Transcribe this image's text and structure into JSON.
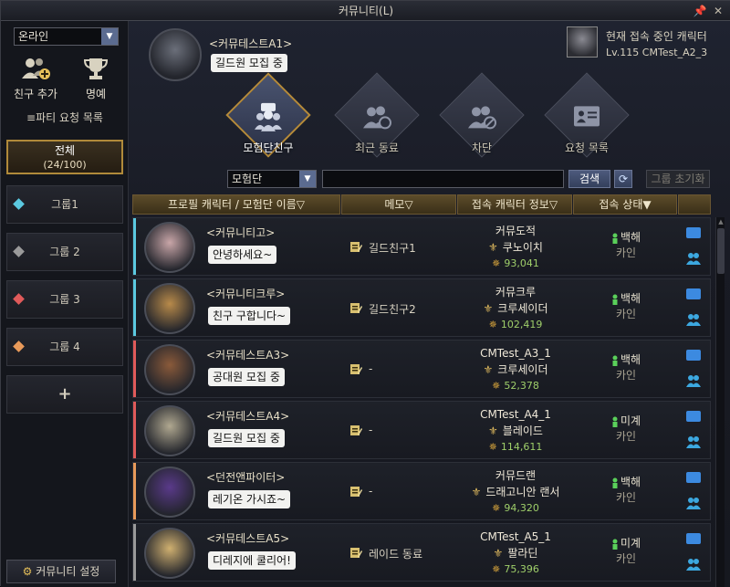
{
  "window": {
    "title": "커뮤니티(L)"
  },
  "left": {
    "status_value": "온라인",
    "add_friend_label": "친구 추가",
    "honor_label": "명예",
    "party_request_label": "≡파티 요청 목록",
    "all_label": "전체",
    "all_count": "(24/100)",
    "groups": [
      {
        "label": "그룹1",
        "color": "#5bc9e0"
      },
      {
        "label": "그룹 2",
        "color": "#9a9a9a"
      },
      {
        "label": "그룹 3",
        "color": "#e05a5a"
      },
      {
        "label": "그룹 4",
        "color": "#e89a5a"
      }
    ],
    "add_group_label": "+",
    "settings_label": "커뮤니티 설정"
  },
  "me": {
    "name": "<커뮤테스트A1>",
    "message": "길드원 모집 중",
    "current_label": "현재 접속 중인 캐릭터",
    "current_info": "Lv.115 CMTest_A2_3"
  },
  "tabs": [
    {
      "label": "모험단친구",
      "icon": "adventure-friends-icon"
    },
    {
      "label": "최근 동료",
      "icon": "recent-party-icon"
    },
    {
      "label": "차단",
      "icon": "block-icon"
    },
    {
      "label": "요청 목록",
      "icon": "request-list-icon"
    }
  ],
  "search": {
    "filter_value": "모험단",
    "query": "",
    "search_label": "검색",
    "reset_label": "그룹 초기화"
  },
  "columns": [
    "프로필 캐릭터 / 모험단 이름▽",
    "메모▽",
    "접속 캐릭터 정보▽",
    "접속 상태▼"
  ],
  "friends": [
    {
      "name": "<커뮤니티고>",
      "message": "안녕하세요~",
      "memo": "길드친구1",
      "char_name": "커뮤도적",
      "job": "쿠노이치",
      "power": "93,041",
      "server": "백해",
      "channel": "카인",
      "group_color": "#5bc9e0",
      "avatar_color": "#c9a6a8"
    },
    {
      "name": "<커뮤니티크루>",
      "message": "친구 구합니다~",
      "memo": "길드친구2",
      "char_name": "커뮤크루",
      "job": "크루세이더",
      "power": "102,419",
      "server": "백해",
      "channel": "카인",
      "group_color": "#5bc9e0",
      "avatar_color": "#b88a4a"
    },
    {
      "name": "<커뮤테스트A3>",
      "message": "공대원 모집 중",
      "memo": "-",
      "char_name": "CMTest_A3_1",
      "job": "크루세이더",
      "power": "52,378",
      "server": "백해",
      "channel": "카인",
      "group_color": "#e05a5a",
      "avatar_color": "#8a5a3a"
    },
    {
      "name": "<커뮤테스트A4>",
      "message": "길드원 모집 중",
      "memo": "-",
      "char_name": "CMTest_A4_1",
      "job": "블레이드",
      "power": "114,611",
      "server": "미계",
      "channel": "카인",
      "group_color": "#e05a5a",
      "avatar_color": "#b0a890"
    },
    {
      "name": "<던전앤파이터>",
      "message": "레기온 가시죠~",
      "memo": "-",
      "char_name": "커뮤드랜",
      "job": "드래고니안 랜서",
      "power": "94,320",
      "server": "백해",
      "channel": "카인",
      "group_color": "#e89a5a",
      "avatar_color": "#5a3a8a"
    },
    {
      "name": "<커뮤테스트A5>",
      "message": "디레지에 쿨리어!",
      "memo": "레이드 동료",
      "char_name": "CMTest_A5_1",
      "job": "팔라딘",
      "power": "75,396",
      "server": "미계",
      "channel": "카인",
      "group_color": "#9a9a9a",
      "avatar_color": "#d0b070"
    }
  ]
}
